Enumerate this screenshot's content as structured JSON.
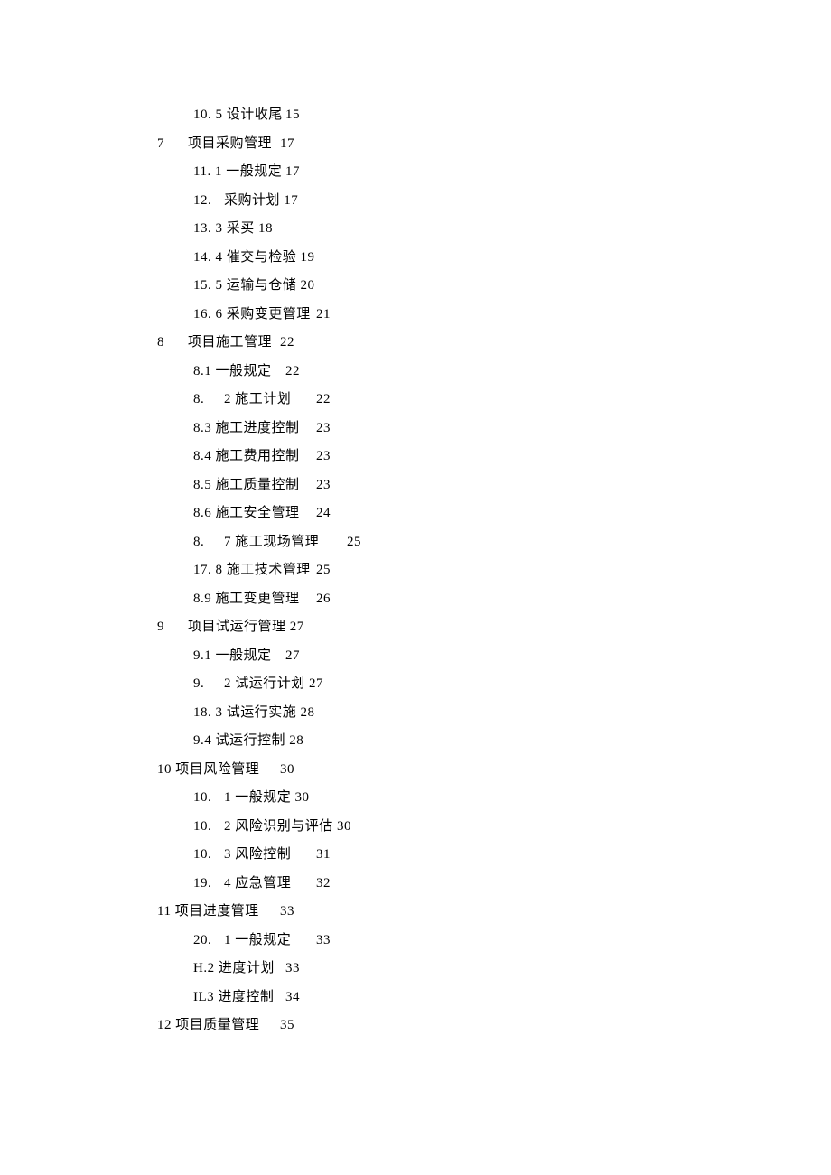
{
  "toc": [
    {
      "level": 1,
      "text": "10. 5 设计收尾\t15"
    },
    {
      "level": 0,
      "text": "7\t项目采购管理\t17"
    },
    {
      "level": 1,
      "text": "11. 1 一般规定\t17"
    },
    {
      "level": 1,
      "text": "12.\t采购计划 17"
    },
    {
      "level": 1,
      "text": "13. 3 采买 18"
    },
    {
      "level": 1,
      "text": "14. 4 催交与检验 19"
    },
    {
      "level": 1,
      "text": "15. 5 运输与仓储 20"
    },
    {
      "level": 1,
      "text": "16. 6 采购变更管理\t21"
    },
    {
      "level": 0,
      "text": "8\t项目施工管理\t22"
    },
    {
      "level": 1,
      "text": "8.1 一般规定\t22"
    },
    {
      "level": 1,
      "text": "8.\t2 施工计划\t22"
    },
    {
      "level": 1,
      "text": "8.3 施工进度控制\t23"
    },
    {
      "level": 1,
      "text": "8.4 施工费用控制\t23"
    },
    {
      "level": 1,
      "text": "8.5 施工质量控制\t23"
    },
    {
      "level": 1,
      "text": "8.6 施工安全管理\t24"
    },
    {
      "level": 1,
      "text": "8.\t7 施工现场管理\t25"
    },
    {
      "level": 1,
      "text": "17. 8 施工技术管理\t25"
    },
    {
      "level": 1,
      "text": "8.9 施工变更管理\t26"
    },
    {
      "level": 0,
      "text": "9\t项目试运行管理 27"
    },
    {
      "level": 1,
      "text": "9.1 一般规定\t27"
    },
    {
      "level": 1,
      "text": "9.\t2 试运行计划 27"
    },
    {
      "level": 1,
      "text": "18. 3 试运行实施 28"
    },
    {
      "level": 1,
      "text": "9.4 试运行控制 28"
    },
    {
      "level": 0,
      "text": "10 项目风险管理\t30"
    },
    {
      "level": 1,
      "text": "10.\t1 一般规定 30"
    },
    {
      "level": 1,
      "text": "10.\t2 风险识别与评估 30"
    },
    {
      "level": 1,
      "text": "10.\t3 风险控制\t31"
    },
    {
      "level": 1,
      "text": "19.\t4 应急管理\t32"
    },
    {
      "level": 0,
      "text": "11 项目进度管理\t33"
    },
    {
      "level": 1,
      "text": "20.\t1 一般规定\t33"
    },
    {
      "level": 1,
      "text": "H.2 进度计划\t33"
    },
    {
      "level": 1,
      "text": "IL3 进度控制\t34"
    },
    {
      "level": 0,
      "text": "12 项目质量管理\t35"
    }
  ]
}
